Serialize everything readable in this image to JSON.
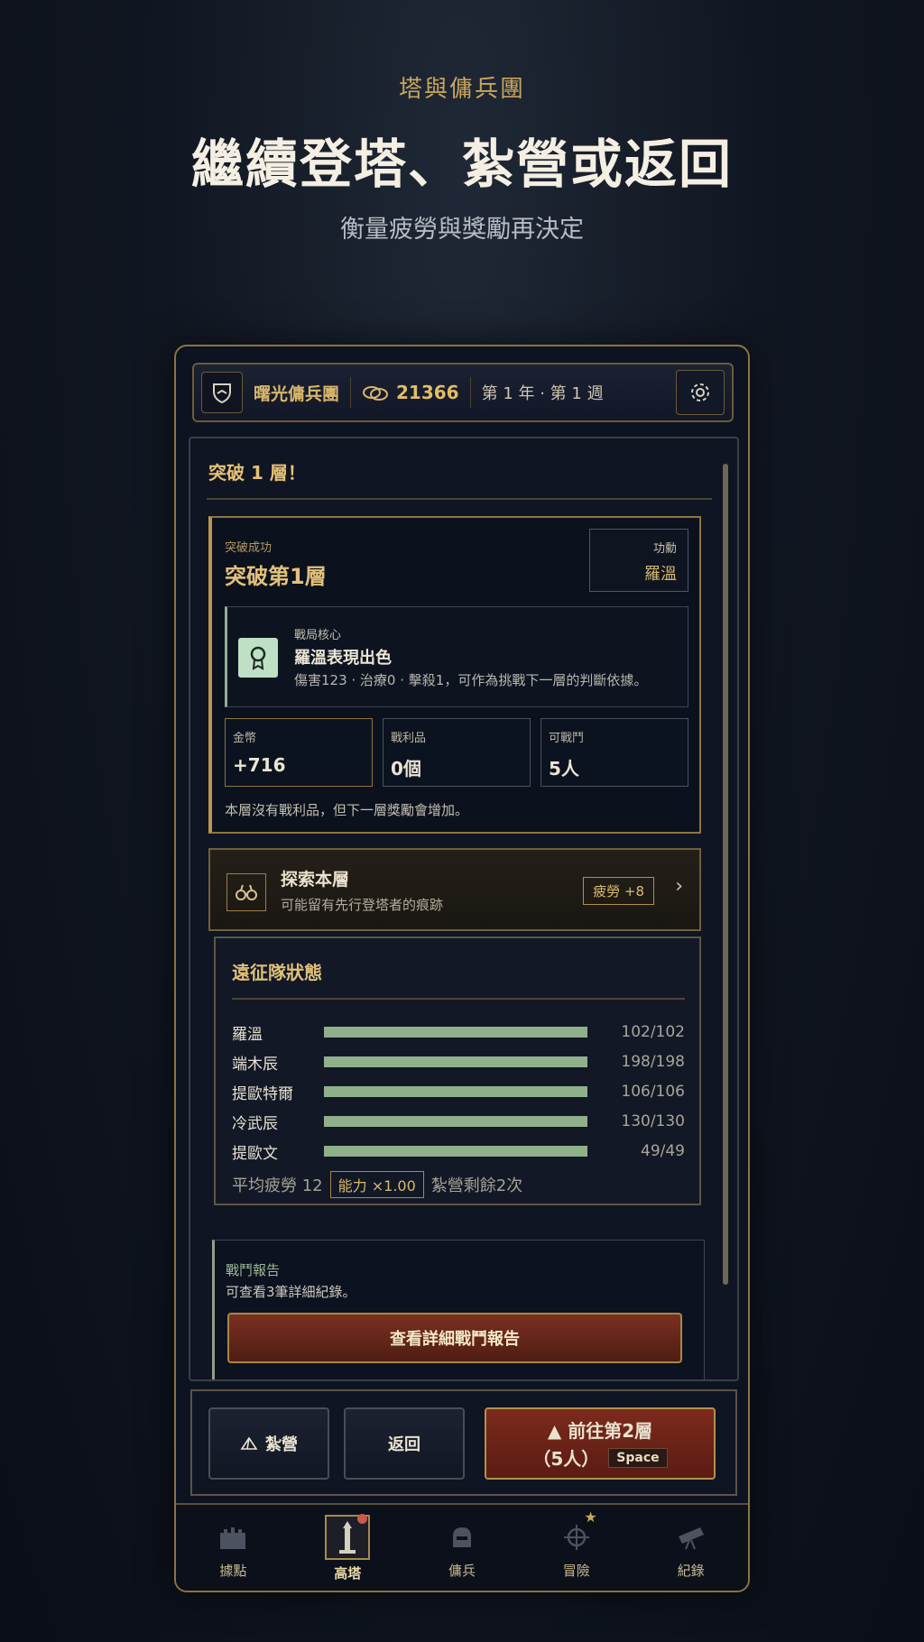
{
  "hero": {
    "kicker": "塔與傭兵團",
    "title": "繼續登塔、紮營或返回",
    "subtitle": "衡量疲勞與獎勵再決定"
  },
  "topbar": {
    "guild_name": "曙光傭兵團",
    "gold": "21366",
    "date": "第 1 年 · 第 1 週",
    "shield_icon": "shield-icon",
    "settings_icon": "gear-icon"
  },
  "floor": {
    "title": "突破 1 層！"
  },
  "success": {
    "small": "突破成功",
    "big": "突破第1層",
    "mvp_label": "功勳",
    "mvp_value": "羅溫",
    "core_label": "戰局核心",
    "core_title": "羅溫表現出色",
    "core_desc": "傷害123 · 治療0 · 擊殺1，可作為挑戰下一層的判斷依據。",
    "stats": [
      {
        "label": "金幣",
        "value": "+716"
      },
      {
        "label": "戰利品",
        "value": "0個"
      },
      {
        "label": "可戰鬥",
        "value": "5人"
      }
    ],
    "note": "本層沒有戰利品，但下一層獎勵會增加。"
  },
  "explore": {
    "title": "探索本層",
    "desc": "可能留有先行登塔者的痕跡",
    "tag": "疲勞 +8",
    "chevron": "›"
  },
  "team": {
    "title": "遠征隊狀態",
    "members": [
      {
        "name": "羅溫",
        "hp": "102/102",
        "ratio": 1.0
      },
      {
        "name": "端木辰",
        "hp": "198/198",
        "ratio": 1.0
      },
      {
        "name": "提歐特爾",
        "hp": "106/106",
        "ratio": 1.0
      },
      {
        "name": "冷武辰",
        "hp": "130/130",
        "ratio": 1.0
      },
      {
        "name": "提歐文",
        "hp": "49/49",
        "ratio": 1.0
      }
    ],
    "fatigue": "平均疲勞 12",
    "ability": "能力 ×1.00",
    "camp_left": "紮營剩餘2次"
  },
  "battle": {
    "label": "戰鬥報告",
    "desc": "可查看3筆詳細紀錄。",
    "button": "查看詳細戰鬥報告"
  },
  "actions": {
    "camp": "紮營",
    "return": "返回",
    "go_line1": "▲ 前往第2層",
    "go_line2": "（5人）",
    "key": "Space"
  },
  "nav": [
    {
      "label": "據點",
      "icon": "castle-icon"
    },
    {
      "label": "高塔",
      "icon": "tower-icon"
    },
    {
      "label": "傭兵",
      "icon": "helmet-icon"
    },
    {
      "label": "冒險",
      "icon": "compass-icon"
    },
    {
      "label": "紀錄",
      "icon": "telescope-icon"
    }
  ],
  "colors": {
    "accent_gold": "#d8b56b",
    "hp_green": "#8fb08a",
    "primary_red": "#7c2a1c"
  }
}
